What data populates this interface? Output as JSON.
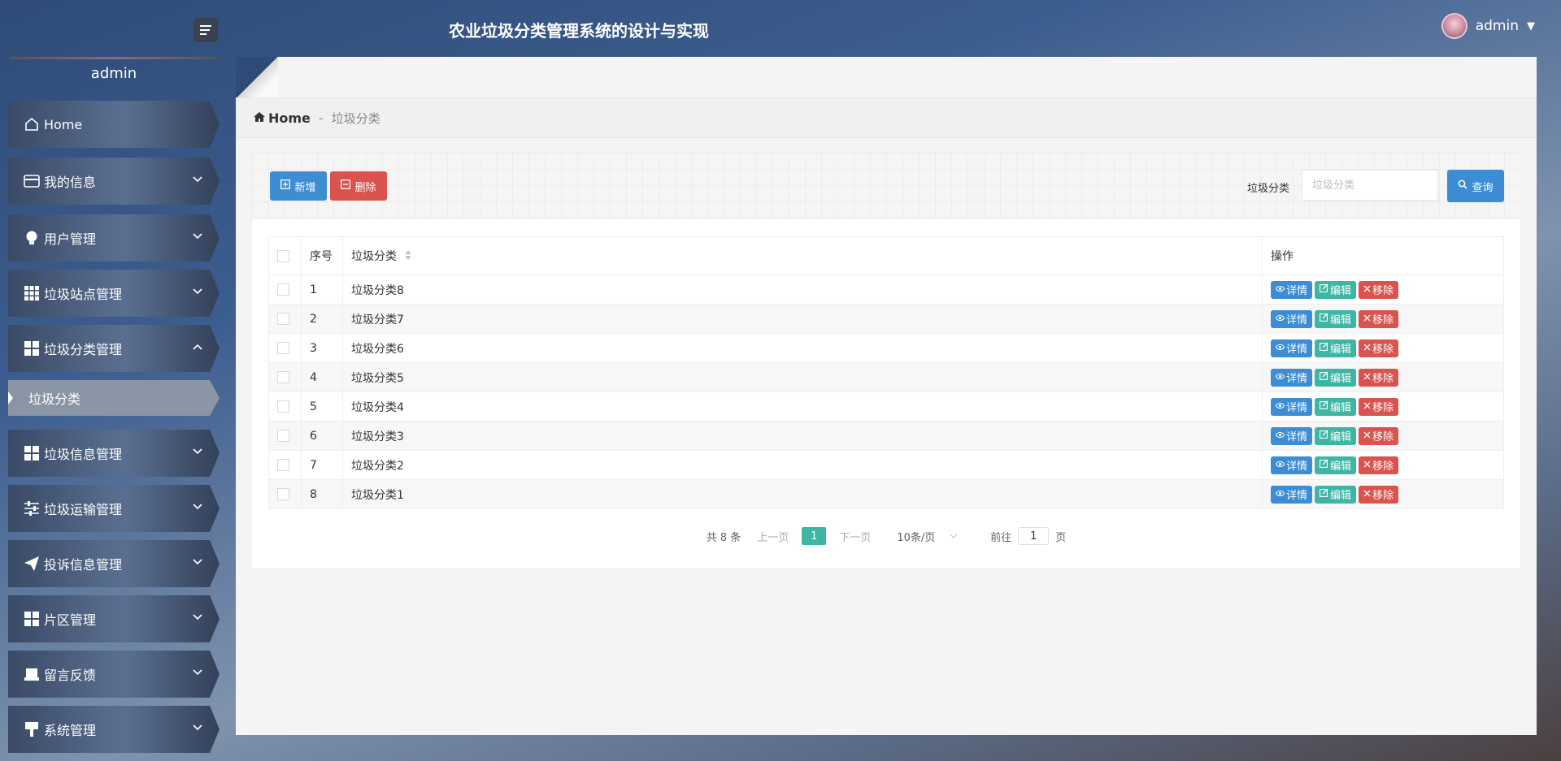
{
  "header": {
    "title": "农业垃圾分类管理系统的设计与实现",
    "user": "admin"
  },
  "sidebar": {
    "username": "admin",
    "items": [
      {
        "label": "Home",
        "icon": "home-icon"
      },
      {
        "label": "我的信息",
        "icon": "card-icon"
      },
      {
        "label": "用户管理",
        "icon": "bulb-icon"
      },
      {
        "label": "垃圾站点管理",
        "icon": "grid-icon"
      },
      {
        "label": "垃圾分类管理",
        "icon": "tiles-icon"
      },
      {
        "label": "垃圾信息管理",
        "icon": "tiles-icon"
      },
      {
        "label": "垃圾运输管理",
        "icon": "sliders-icon"
      },
      {
        "label": "投诉信息管理",
        "icon": "send-icon"
      },
      {
        "label": "片区管理",
        "icon": "tiles-icon"
      },
      {
        "label": "留言反馈",
        "icon": "inbox-icon"
      },
      {
        "label": "系统管理",
        "icon": "pin-icon"
      }
    ],
    "active_sub": "垃圾分类"
  },
  "breadcrumb": {
    "home": "Home",
    "separator": "-",
    "current": "垃圾分类"
  },
  "toolbar": {
    "add_label": "新增",
    "delete_label": "删除",
    "search_label": "垃圾分类",
    "search_placeholder": "垃圾分类",
    "search_button": "查询"
  },
  "table": {
    "headers": {
      "index": "序号",
      "category": "垃圾分类",
      "actions": "操作"
    },
    "rows": [
      {
        "index": "1",
        "category": "垃圾分类8"
      },
      {
        "index": "2",
        "category": "垃圾分类7"
      },
      {
        "index": "3",
        "category": "垃圾分类6"
      },
      {
        "index": "4",
        "category": "垃圾分类5"
      },
      {
        "index": "5",
        "category": "垃圾分类4"
      },
      {
        "index": "6",
        "category": "垃圾分类3"
      },
      {
        "index": "7",
        "category": "垃圾分类2"
      },
      {
        "index": "8",
        "category": "垃圾分类1"
      }
    ],
    "row_actions": {
      "detail": "详情",
      "edit": "编辑",
      "remove": "移除"
    }
  },
  "pagination": {
    "total": "共 8 条",
    "prev": "上一页",
    "current": "1",
    "next": "下一页",
    "page_size": "10条/页",
    "goto_label": "前往",
    "goto_value": "1",
    "goto_suffix": "页"
  },
  "colors": {
    "primary": "#3c8dd4",
    "success": "#3fb5a3",
    "danger": "#d9534f"
  }
}
